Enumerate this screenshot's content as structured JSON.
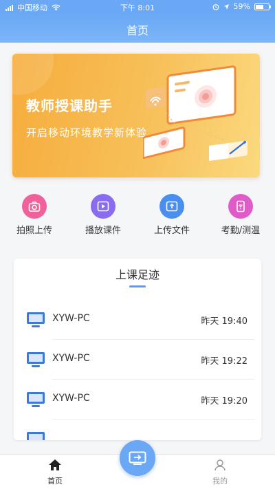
{
  "status_bar": {
    "carrier": "中国移动",
    "time": "下午 8:01",
    "battery": "59%",
    "battery_level": 0.59
  },
  "header": {
    "title": "首页"
  },
  "banner": {
    "title": "教师授课助手",
    "subtitle": "开启移动环境教学新体验"
  },
  "quick_actions": [
    {
      "label": "拍照上传",
      "icon": "camera-icon",
      "color": "#f0609a"
    },
    {
      "label": "播放课件",
      "icon": "play-icon",
      "color": "#8a6cf0"
    },
    {
      "label": "上传文件",
      "icon": "upload-icon",
      "color": "#4a8ef0"
    },
    {
      "label": "考勤/测温",
      "icon": "attendance-icon",
      "color": "#e05ac8"
    }
  ],
  "history": {
    "title": "上课足迹",
    "items": [
      {
        "device": "XYW-PC",
        "time": "昨天 19:40"
      },
      {
        "device": "XYW-PC",
        "time": "昨天 19:22"
      },
      {
        "device": "XYW-PC",
        "time": "昨天 19:20"
      }
    ]
  },
  "tab_bar": {
    "home": "首页",
    "mine": "我的"
  },
  "colors": {
    "primary": "#6aa8f5",
    "banner_start": "#f6ad3c",
    "banner_end": "#fbd97e"
  }
}
